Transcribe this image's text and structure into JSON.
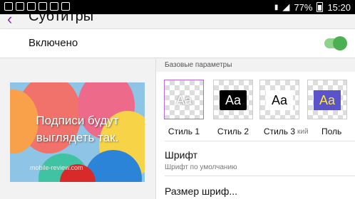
{
  "status_bar": {
    "battery": "77%",
    "time": "15:20",
    "left_icons": [
      "gallery-icon",
      "cast-icon",
      "mail-icon",
      "screenshot-icon",
      "image-icon",
      "bag-icon"
    ],
    "right_icons": [
      "sim-icon",
      "signal-icon",
      "battery-icon"
    ]
  },
  "header": {
    "title": "Субтитры"
  },
  "toggle": {
    "label": "Включено",
    "on": true
  },
  "preview": {
    "line1": "Подписи будут",
    "line2": "выглядеть так.",
    "watermark": "mobile-review.com"
  },
  "styles_section": {
    "header": "Базовые параметры",
    "items": [
      {
        "label": "Стиль 1",
        "sample": "Aa",
        "selected": true
      },
      {
        "label": "Стиль 2",
        "sample": "Aa"
      },
      {
        "label": "Стиль 3",
        "sample": "Aa"
      },
      {
        "label": "Поль",
        "sample": "Aa",
        "partial_prefix": "кий"
      }
    ]
  },
  "font": {
    "title": "Шрифт",
    "value": "Шрифт по умолчанию"
  },
  "size": {
    "title": "Размер шриф..."
  },
  "colors": {
    "accent": "#7a2db4",
    "switch_on": "#4caf50",
    "selected_border": "#b36ad6"
  }
}
